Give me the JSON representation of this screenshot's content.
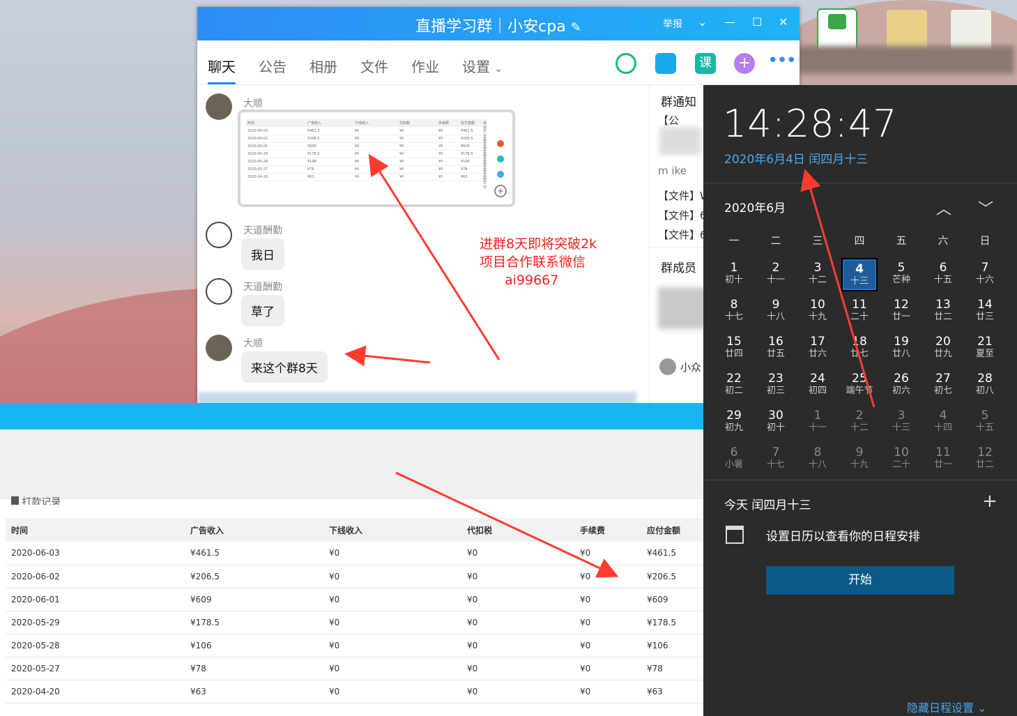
{
  "chat": {
    "title": "直播学习群｜小安cpa",
    "report": "举报",
    "tabs": [
      "聊天",
      "公告",
      "相册",
      "文件",
      "作业",
      "设置"
    ],
    "messages": [
      {
        "sender": "大顺",
        "type": "image"
      },
      {
        "sender": "天道酬勤",
        "text": "我日"
      },
      {
        "sender": "天道酬勤",
        "text": "草了"
      },
      {
        "sender": "大顺",
        "text": "来这个群8天"
      }
    ],
    "side": {
      "notice_title": "群通知",
      "notice_prefix": "【公",
      "notice_snippet": "m ike",
      "files": [
        "【文件】W",
        "【文件】6",
        "【文件】6"
      ],
      "members_title": "群成员",
      "member_name": "小众"
    },
    "thumb_headers": [
      "时间",
      "广告收入",
      "下线收入",
      "代扣税",
      "手续费",
      "应付金额",
      "状态"
    ],
    "thumb_rows": [
      [
        "2020-06-03",
        "¥461.5",
        "¥0",
        "¥0",
        "¥0",
        "¥461.5",
        "已支付"
      ],
      [
        "2020-06-02",
        "¥206.5",
        "¥0",
        "¥0",
        "¥0",
        "¥206.5",
        "已支付"
      ],
      [
        "2020-06-01",
        "¥609",
        "¥0",
        "¥0",
        "¥0",
        "¥609",
        "已支付"
      ],
      [
        "2020-05-29",
        "¥178.5",
        "¥0",
        "¥0",
        "¥0",
        "¥178.5",
        "已支付"
      ],
      [
        "2020-05-28",
        "¥106",
        "¥0",
        "¥0",
        "¥0",
        "¥106",
        "已支付"
      ],
      [
        "2020-05-27",
        "¥78",
        "¥0",
        "¥0",
        "¥0",
        "¥78",
        "已支付"
      ],
      [
        "2020-04-20",
        "¥63",
        "¥0",
        "¥0",
        "¥0",
        "¥63",
        "已支付"
      ]
    ]
  },
  "annotation": {
    "line1": "进群8天即将突破2k",
    "line2": "项目合作联系微信",
    "line3": "ai99667",
    "color": "#ff2020"
  },
  "earnings": {
    "section_title": "█ 打款记录",
    "headers": [
      "时间",
      "广告收入",
      "下线收入",
      "代扣税",
      "手续费",
      "应付金额"
    ],
    "rows": [
      [
        "2020-06-03",
        "¥461.5",
        "¥0",
        "¥0",
        "¥0",
        "¥461.5"
      ],
      [
        "2020-06-02",
        "¥206.5",
        "¥0",
        "¥0",
        "¥0",
        "¥206.5"
      ],
      [
        "2020-06-01",
        "¥609",
        "¥0",
        "¥0",
        "¥0",
        "¥609"
      ],
      [
        "2020-05-29",
        "¥178.5",
        "¥0",
        "¥0",
        "¥0",
        "¥178.5"
      ],
      [
        "2020-05-28",
        "¥106",
        "¥0",
        "¥0",
        "¥0",
        "¥106"
      ],
      [
        "2020-05-27",
        "¥78",
        "¥0",
        "¥0",
        "¥0",
        "¥78"
      ],
      [
        "2020-04-20",
        "¥63",
        "¥0",
        "¥0",
        "¥0",
        "¥63"
      ]
    ]
  },
  "calendar": {
    "time": "14:28:47",
    "date_line": "2020年6月4日 闰四月十三",
    "month_label": "2020年6月",
    "weekdays": [
      "一",
      "二",
      "三",
      "四",
      "五",
      "六",
      "日"
    ],
    "days": [
      {
        "n": "1",
        "l": "初十"
      },
      {
        "n": "2",
        "l": "十一"
      },
      {
        "n": "3",
        "l": "十二"
      },
      {
        "n": "4",
        "l": "十三",
        "today": true
      },
      {
        "n": "5",
        "l": "芒种"
      },
      {
        "n": "6",
        "l": "十五"
      },
      {
        "n": "7",
        "l": "十六"
      },
      {
        "n": "8",
        "l": "十七"
      },
      {
        "n": "9",
        "l": "十八"
      },
      {
        "n": "10",
        "l": "十九"
      },
      {
        "n": "11",
        "l": "二十"
      },
      {
        "n": "12",
        "l": "廿一"
      },
      {
        "n": "13",
        "l": "廿二"
      },
      {
        "n": "14",
        "l": "廿三"
      },
      {
        "n": "15",
        "l": "廿四"
      },
      {
        "n": "16",
        "l": "廿五"
      },
      {
        "n": "17",
        "l": "廿六"
      },
      {
        "n": "18",
        "l": "廿七"
      },
      {
        "n": "19",
        "l": "廿八"
      },
      {
        "n": "20",
        "l": "廿九"
      },
      {
        "n": "21",
        "l": "夏至"
      },
      {
        "n": "22",
        "l": "初二"
      },
      {
        "n": "23",
        "l": "初三"
      },
      {
        "n": "24",
        "l": "初四"
      },
      {
        "n": "25",
        "l": "端午节"
      },
      {
        "n": "26",
        "l": "初六"
      },
      {
        "n": "27",
        "l": "初七"
      },
      {
        "n": "28",
        "l": "初八"
      },
      {
        "n": "29",
        "l": "初九"
      },
      {
        "n": "30",
        "l": "初十"
      },
      {
        "n": "1",
        "l": "十一",
        "dim": true
      },
      {
        "n": "2",
        "l": "十二",
        "dim": true
      },
      {
        "n": "3",
        "l": "十三",
        "dim": true
      },
      {
        "n": "4",
        "l": "十四",
        "dim": true
      },
      {
        "n": "5",
        "l": "十五",
        "dim": true
      },
      {
        "n": "6",
        "l": "小暑",
        "dim": true
      },
      {
        "n": "7",
        "l": "十七",
        "dim": true
      },
      {
        "n": "8",
        "l": "十八",
        "dim": true
      },
      {
        "n": "9",
        "l": "十九",
        "dim": true
      },
      {
        "n": "10",
        "l": "二十",
        "dim": true
      },
      {
        "n": "11",
        "l": "廿一",
        "dim": true
      },
      {
        "n": "12",
        "l": "廿二",
        "dim": true
      }
    ],
    "agenda_today": "今天 闰四月十三",
    "agenda_hint": "设置日历以查看你的日程安排",
    "start_button": "开始",
    "hide_agenda": "隐藏日程设置"
  },
  "colors": {
    "accent": "#1d8cf2",
    "calendar_bg": "#2b2b2b",
    "arrow": "#ff3b30"
  }
}
